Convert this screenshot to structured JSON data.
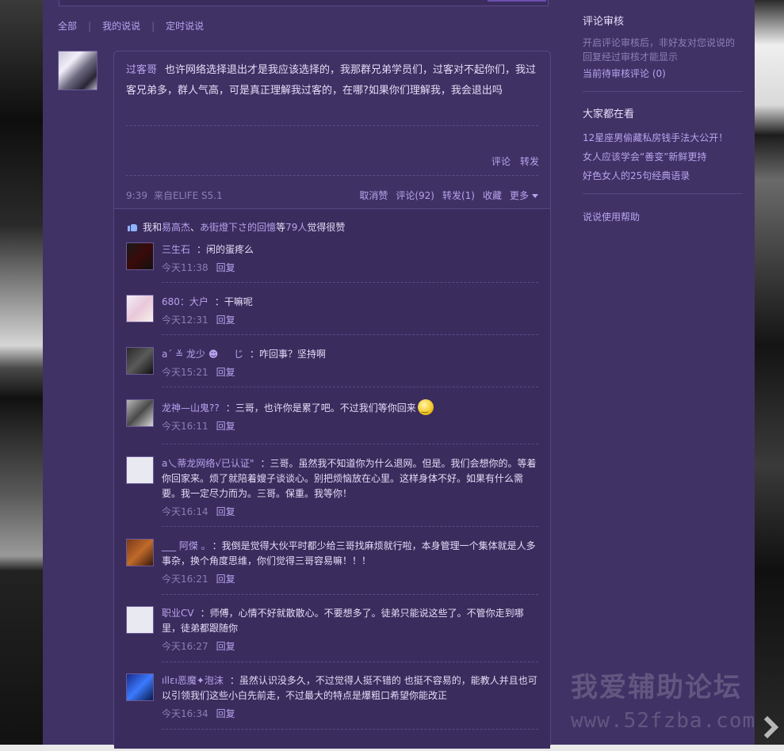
{
  "tabs": {
    "all": "全部",
    "mine": "我的说说",
    "scheduled": "定时说说",
    "separator": "|"
  },
  "post": {
    "author": "过客哥",
    "text": "也许网络选择退出才是我应该选择的，我那群兄弟学员们，过客对不起你们，我过客兄弟多，群人气高，可是真正理解我过客的，在哪?如果你们理解我，我会退出吗",
    "comment_label": "评论",
    "forward_label": "转发",
    "time": "9:39",
    "source": "来自ELIFE S5.1",
    "ops": {
      "unlike": "取消赞",
      "comments": "评论(92)",
      "forwards": "转发(1)",
      "favorite": "收藏",
      "more": "更多"
    }
  },
  "likes": {
    "prefix": "我和",
    "user1": "易高杰",
    "sep": "、",
    "user2": "あ街燈下さ的回憶",
    "mid": " 等",
    "count": "79人",
    "suffix": "觉得很赞"
  },
  "reply_label": "回复",
  "comments": [
    {
      "name": "三生石",
      "text": "：闲的蛋疼么",
      "time": "今天11:38"
    },
    {
      "name": "680：大户",
      "text": "：干嘛呢",
      "time": "今天12:31"
    },
    {
      "name": "a´ ≚ 龙少 ☻ 　 じ",
      "text": "：咋回事？坚持啊",
      "time": "今天15:21"
    },
    {
      "name": "龙神—山鬼??",
      "text": "：三哥，也许你是累了吧。不过我们等你回来",
      "time": "今天16:11"
    },
    {
      "name": "a乀蒂龙网络√已认证\"",
      "text": "：三哥。虽然我不知道你为什么退网。但是。我们会想你的。等着你回家来。烦了就陪着嫂子谈谈心。别把烦恼放在心里。这样身体不好。如果有什么需要。我一定尽力而为。三哥。保重。我等你！",
      "time": "今天16:14"
    },
    {
      "name": "___ 阿傑 。",
      "text": "：我倒是觉得大伙平时都少给三哥找麻烦就行啦，本身管理一个集体就是人多事杂，换个角度思维，你们觉得三哥容易嘛！！！",
      "time": "今天16:21"
    },
    {
      "name": "职业CV",
      "text": "：师傅，心情不好就散散心。不要想多了。徒弟只能说这些了。不管你走到哪里，徒弟都跟随你",
      "time": "今天16:27"
    },
    {
      "name": "ıllεı恶魔✦泡沫",
      "text": "：虽然认识没多久，不过觉得人挺不错的 也挺不容易的，能教人并且也可以引领我们这些小白先前走，不过最大的特点是爆粗口希望你能改正",
      "time": "今天16:34"
    }
  ],
  "sidebar": {
    "review_title": "评论审核",
    "review_desc": "开启评论审核后，非好友对您说说的回复经过审核才能显示",
    "review_pending": "当前待审核评论 (0)",
    "trending_title": "大家都在看",
    "trending": [
      "12星座男偷藏私房钱手法大公开！",
      "女人应该学会“善变”新鲜更持",
      "好色女人的25句经典语录"
    ],
    "help": "说说使用帮助"
  },
  "watermark": {
    "line1": "我爱辅助论坛",
    "line2": "www.52fzba.com"
  },
  "colors": {
    "panel": "#403265",
    "link": "#b7a4ef",
    "muted": "#8b7fb3"
  }
}
